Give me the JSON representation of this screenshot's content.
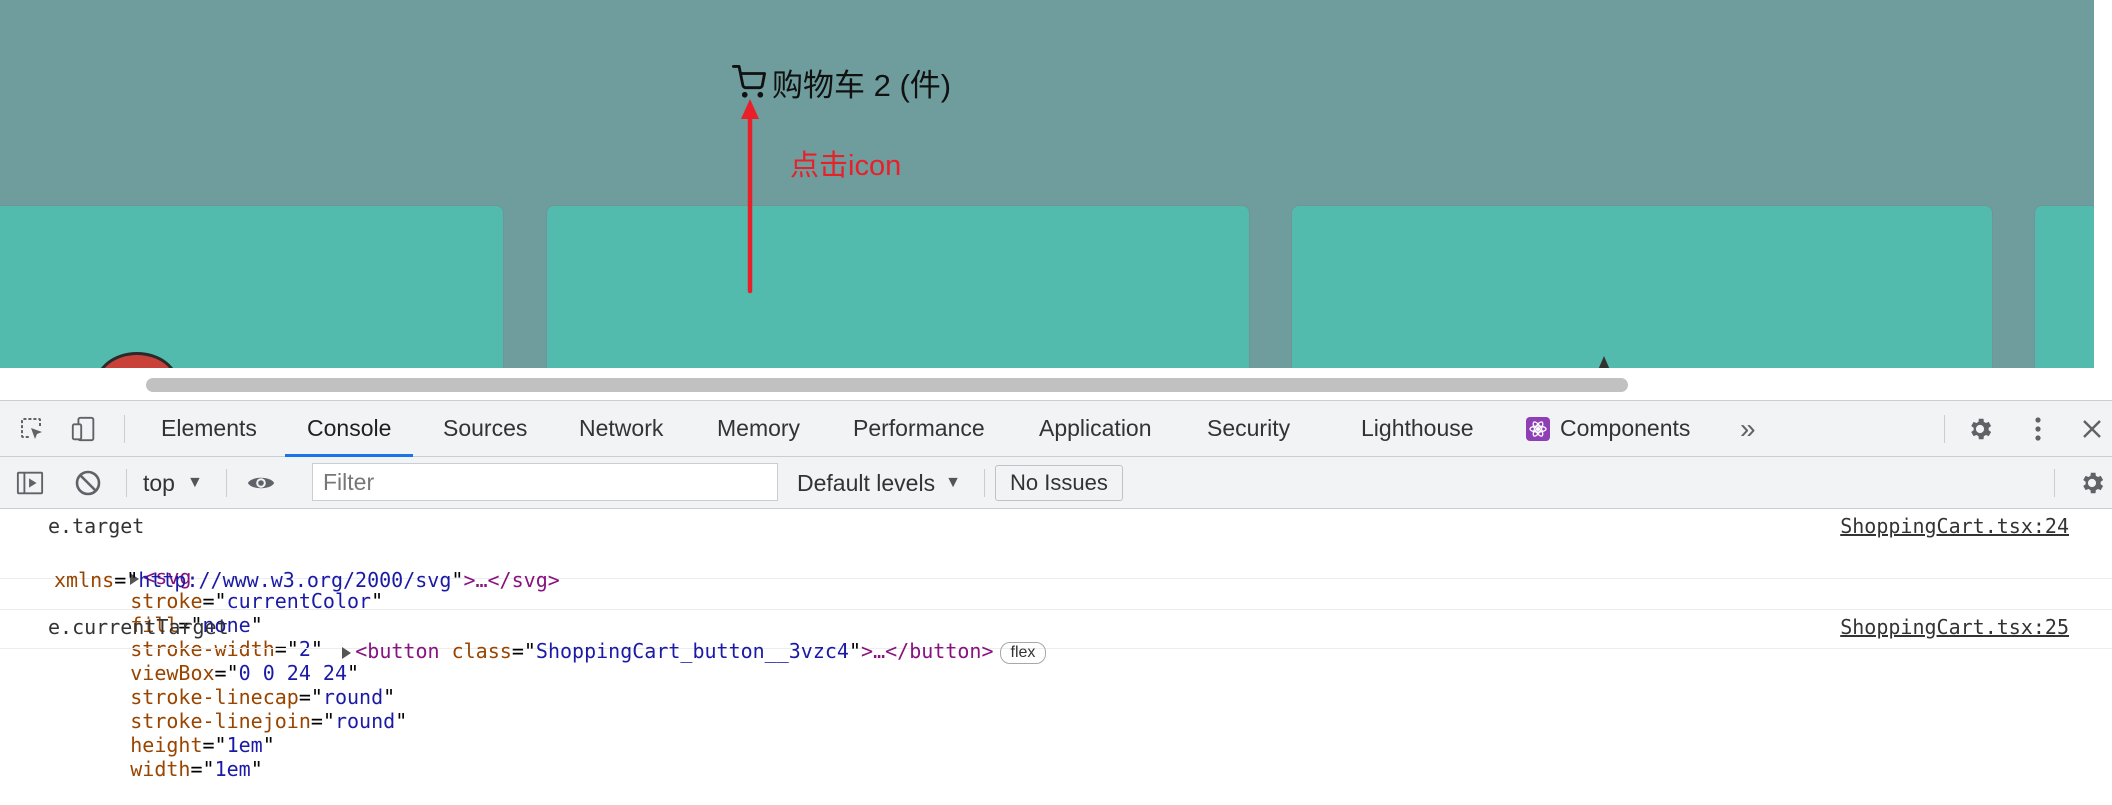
{
  "page": {
    "cart_label": "购物车 2 (件)",
    "annotation": "点击icon",
    "cart_icon": "shopping-cart-icon"
  },
  "devtools": {
    "tabs": [
      {
        "label": "Elements"
      },
      {
        "label": "Console",
        "active": true
      },
      {
        "label": "Sources"
      },
      {
        "label": "Network"
      },
      {
        "label": "Memory"
      },
      {
        "label": "Performance"
      },
      {
        "label": "Application"
      },
      {
        "label": "Security"
      },
      {
        "label": "Lighthouse"
      },
      {
        "label": "Components"
      }
    ],
    "more_tabs": "»",
    "toolbar": {
      "context": "top",
      "filter_placeholder": "Filter",
      "levels": "Default levels",
      "issues": "No Issues"
    },
    "console": {
      "messages": [
        {
          "label": "e.target",
          "source": "ShoppingCart.tsx:24",
          "line1": {
            "open": "<",
            "tag": "svg",
            "attrs": [
              {
                "name": "stroke",
                "value": "currentColor"
              },
              {
                "name": "fill",
                "value": "none"
              },
              {
                "name": "stroke-width",
                "value": "2"
              },
              {
                "name": "viewBox",
                "value": "0 0 24 24"
              },
              {
                "name": "stroke-linecap",
                "value": "round"
              },
              {
                "name": "stroke-linejoin",
                "value": "round"
              },
              {
                "name": "height",
                "value": "1em"
              },
              {
                "name": "width",
                "value": "1em"
              }
            ]
          },
          "line2": {
            "attr_name": "xmlns",
            "attr_value": "http://www.w3.org/2000/svg",
            "tail": ">…</",
            "close_tag": "svg",
            "close": ">"
          }
        },
        {
          "label": "e.currentTarget",
          "source": "ShoppingCart.tsx:25",
          "open": "<",
          "tag": "button",
          "attr_name": "class",
          "attr_value": "ShoppingCart_button__3vzc4",
          "tail": ">…</",
          "close_tag": "button",
          "close": ">",
          "badge": "flex"
        }
      ]
    }
  },
  "colors": {
    "page_bg": "#6f9d9d",
    "card": "#52bbad",
    "annotation": "#e8202a",
    "active_tab_underline": "#1a73e8",
    "tag": "#881280",
    "attr": "#994500",
    "value": "#1a1aa6"
  }
}
